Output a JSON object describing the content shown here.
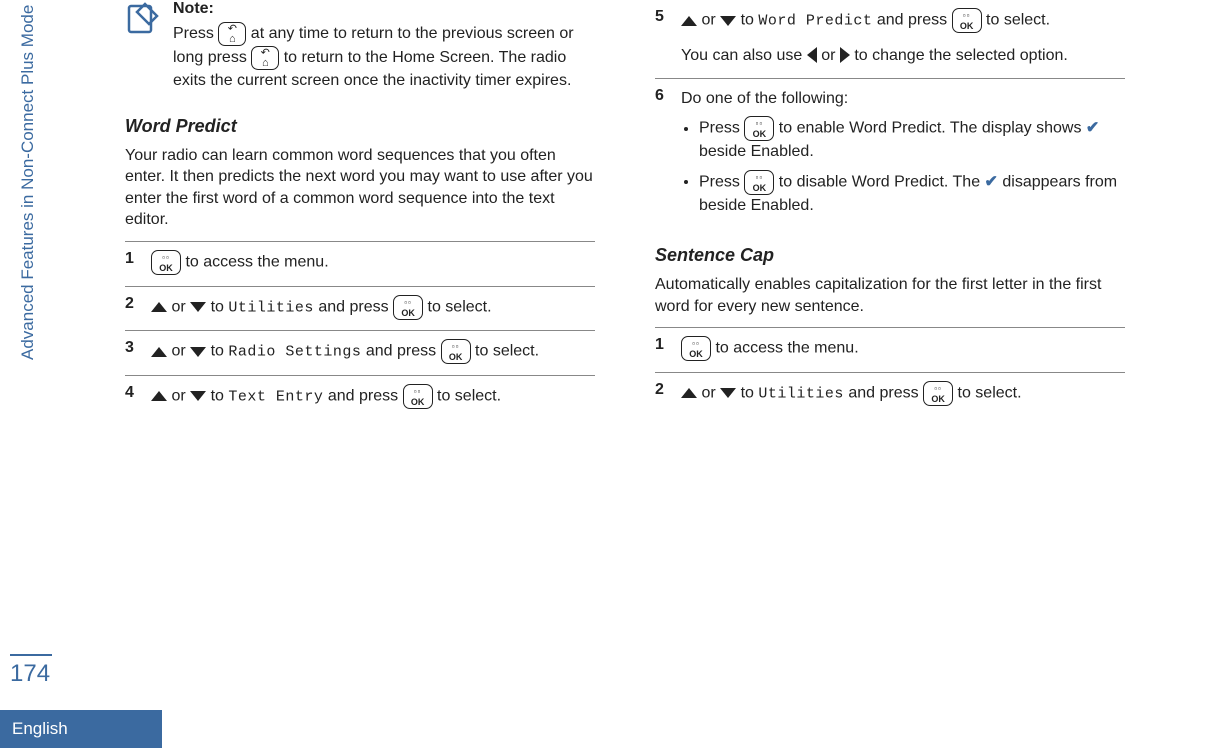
{
  "sidebar": {
    "section_name": "Advanced Features in Non-Connect Plus Mode",
    "page_number": "174",
    "language": "English"
  },
  "note": {
    "title": "Note:",
    "text_1": "Press ",
    "text_2": " at any time to return to the previous screen or long press ",
    "text_3": " to return to the Home Screen. The radio exits the current screen once the inactivity timer expires."
  },
  "word_predict": {
    "heading": "Word Predict",
    "intro": "Your radio can learn common word sequences that you often enter. It then predicts the next word you may want to use after you enter the first word of a common word sequence into the text editor.",
    "steps": {
      "s1": " to access the menu.",
      "s2_a": " or ",
      "s2_b": " to ",
      "s2_menu": "Utilities",
      "s2_c": " and press ",
      "s2_d": " to select.",
      "s3_a": " or ",
      "s3_b": " to ",
      "s3_menu": "Radio Settings",
      "s3_c": " and press ",
      "s3_d": " to select.",
      "s4_a": " or ",
      "s4_b": " to ",
      "s4_menu": "Text Entry",
      "s4_c": " and press ",
      "s4_d": " to select.",
      "s5_a": " or ",
      "s5_b": " to ",
      "s5_menu": "Word Predict",
      "s5_c": " and press ",
      "s5_d": " to select.",
      "s5_extra_a": "You can also use ",
      "s5_extra_b": " or ",
      "s5_extra_c": " to change the selected option.",
      "s6_intro": "Do one of the following:",
      "s6_b1_a": "Press ",
      "s6_b1_b": " to enable Word Predict. The display shows ",
      "s6_b1_c": " beside Enabled.",
      "s6_b2_a": "Press ",
      "s6_b2_b": " to disable Word Predict. The ",
      "s6_b2_c": " disappears from beside Enabled."
    }
  },
  "sentence_cap": {
    "heading": "Sentence Cap",
    "intro": "Automatically enables capitalization for the first letter in the first word for every new sentence.",
    "s1": " to access the menu.",
    "s2_a": " or ",
    "s2_b": " to ",
    "s2_menu": "Utilities",
    "s2_c": " and press ",
    "s2_d": " to select."
  },
  "labels": {
    "num1": "1",
    "num2": "2",
    "num3": "3",
    "num4": "4",
    "num5": "5",
    "num6": "6"
  }
}
